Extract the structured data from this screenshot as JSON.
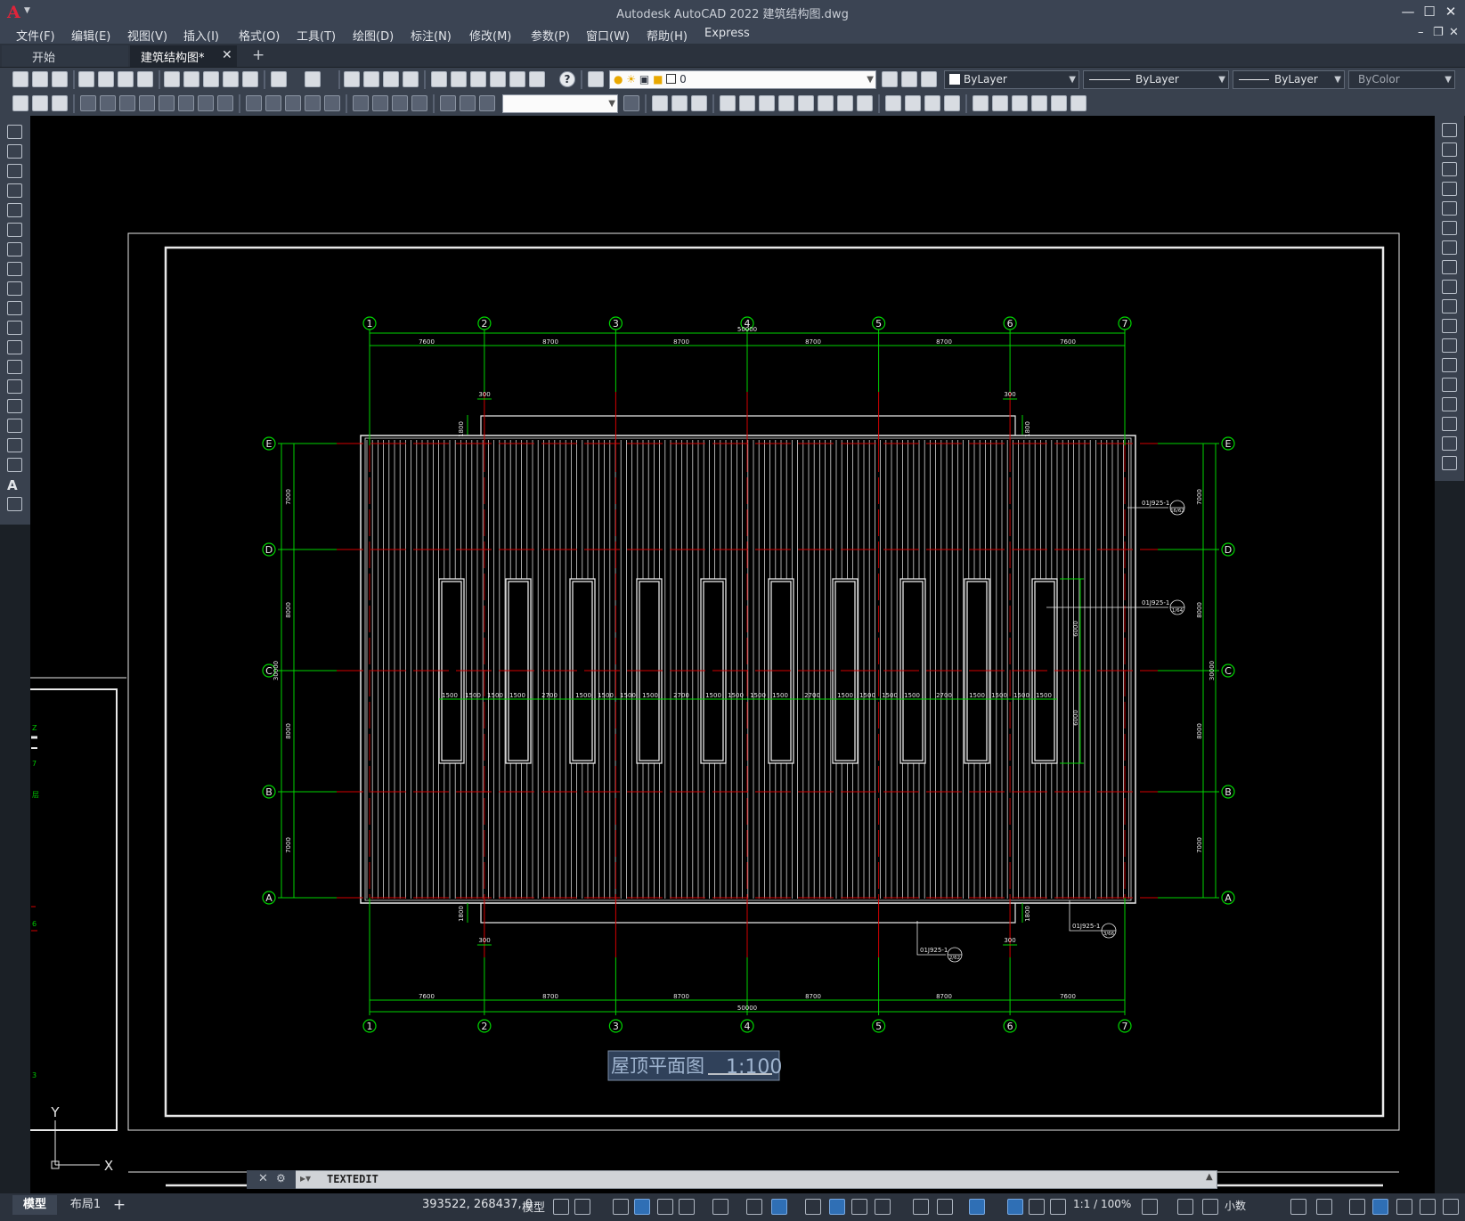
{
  "title_bar": {
    "logo": "A",
    "app_title": "Autodesk AutoCAD 2022    建筑结构图.dwg",
    "minimize": "—",
    "maximize": "☐",
    "close": "✕"
  },
  "menus": [
    "文件(F)",
    "编辑(E)",
    "视图(V)",
    "插入(I)",
    "格式(O)",
    "工具(T)",
    "绘图(D)",
    "标注(N)",
    "修改(M)",
    "参数(P)",
    "窗口(W)",
    "帮助(H)",
    "Express"
  ],
  "doc_window_buttons": {
    "minimize": "–",
    "restore": "❐",
    "close": "✕"
  },
  "tabs": {
    "start": "开始",
    "document": "建筑结构图*",
    "close": "✕",
    "add": "+"
  },
  "layer_controls": {
    "current_layer": "0",
    "color": "ByLayer",
    "linetype": "ByLayer",
    "lineweight": "ByLayer",
    "plotstyle": "ByColor",
    "textstyle": ""
  },
  "drawing": {
    "title": "屋顶平面图",
    "scale": "1:100",
    "grid_cols": [
      "1",
      "2",
      "3",
      "4",
      "5",
      "6",
      "7"
    ],
    "grid_rows": [
      "E",
      "D",
      "C",
      "B",
      "A"
    ],
    "spacing_x": [
      "7600",
      "8700",
      "8700",
      "8700",
      "8700",
      "7600"
    ],
    "total_x": "50000",
    "spacing_y": [
      "7000",
      "8000",
      "8000",
      "7000"
    ],
    "total_y": "30000",
    "offset_300": "300",
    "offset_1800": "1800",
    "skylight_dims": [
      "1500",
      "1500",
      "1500",
      "1500",
      "2700",
      "1500",
      "1500",
      "1500",
      "1500",
      "2700",
      "1500",
      "1500",
      "1500",
      "1500",
      "2700",
      "1500",
      "1500",
      "1500",
      "1500",
      "2700",
      "1500",
      "1500",
      "1500",
      "1500"
    ],
    "skylight_height": "6000",
    "detail_callouts": [
      {
        "ref": "01J925-1",
        "num": "16/62"
      },
      {
        "ref": "01J925-1",
        "num": "1/64"
      },
      {
        "ref": "01J925-1",
        "num": "2/62"
      },
      {
        "ref": "01J925-1",
        "num": "3/66"
      }
    ],
    "ucs_y": "Y",
    "ucs_x": "X"
  },
  "command_line": {
    "text": "TEXTEDIT",
    "close": "✕",
    "settings": "🔧"
  },
  "layout_tabs": {
    "model": "模型",
    "layout1": "布局1",
    "add": "+"
  },
  "status": {
    "coords": "393522, 268437, 0",
    "space": "模型",
    "annotation_scale": "1:1 / 100%",
    "units": "小数"
  },
  "colors": {
    "grid_green": "#00d400",
    "axis_red": "#d40000",
    "roof_white": "#e8e8e8",
    "title_bar": "#3b4453",
    "canvas": "#000000"
  }
}
